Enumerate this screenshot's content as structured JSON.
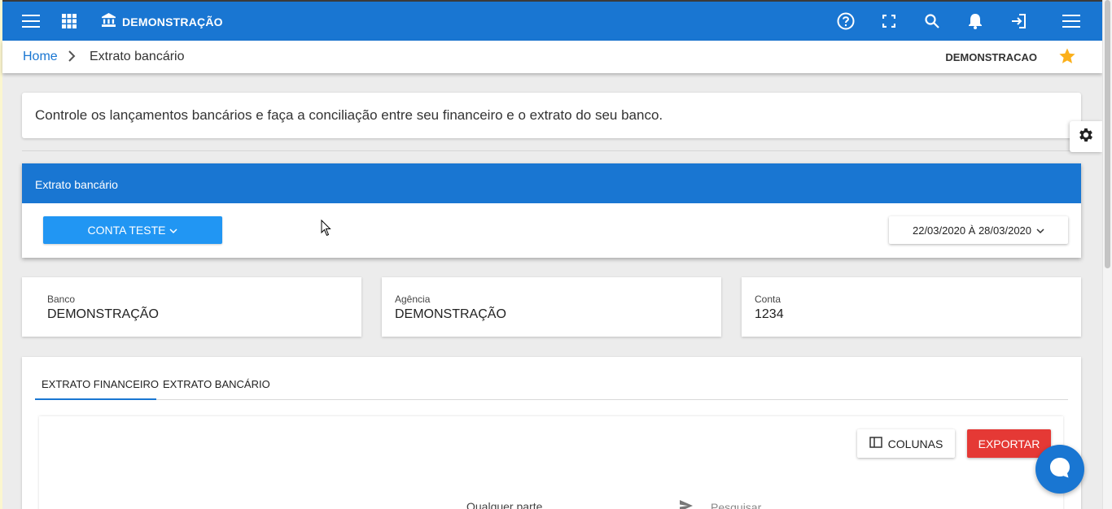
{
  "header": {
    "brand_label": "DEMONSTRAÇÃO",
    "accent_color": "#1976d2",
    "icons": [
      "menu-icon",
      "apps-grid-icon",
      "bank-icon",
      "help-icon",
      "fullscreen-icon",
      "search-icon",
      "bell-icon",
      "logout-icon",
      "hamburger-icon"
    ]
  },
  "breadcrumb": {
    "home": "Home",
    "current": "Extrato bancário",
    "company": "DEMONSTRACAO"
  },
  "info": {
    "description": "Controle os lançamentos bancários e faça a conciliação entre seu financeiro e o extrato do seu banco."
  },
  "panel": {
    "title": "Extrato bancário",
    "account_label": "CONTA TESTE",
    "date_range": "22/03/2020 À 28/03/2020"
  },
  "boxes": [
    {
      "label": "Banco",
      "value": "DEMONSTRAÇÃO"
    },
    {
      "label": "Agência",
      "value": "DEMONSTRAÇÃO"
    },
    {
      "label": "Conta",
      "value": "1234"
    }
  ],
  "tabs": [
    {
      "label": "EXTRATO FINANCEIRO",
      "active": true
    },
    {
      "label": "EXTRATO BANCÁRIO",
      "active": false
    }
  ],
  "toolbar": {
    "columns_label": "COLUNAS",
    "export_label": "EXPORTAR",
    "export_color": "#e53935",
    "filter_mode": "Qualquer parte",
    "search_placeholder": "Pesquisar"
  }
}
